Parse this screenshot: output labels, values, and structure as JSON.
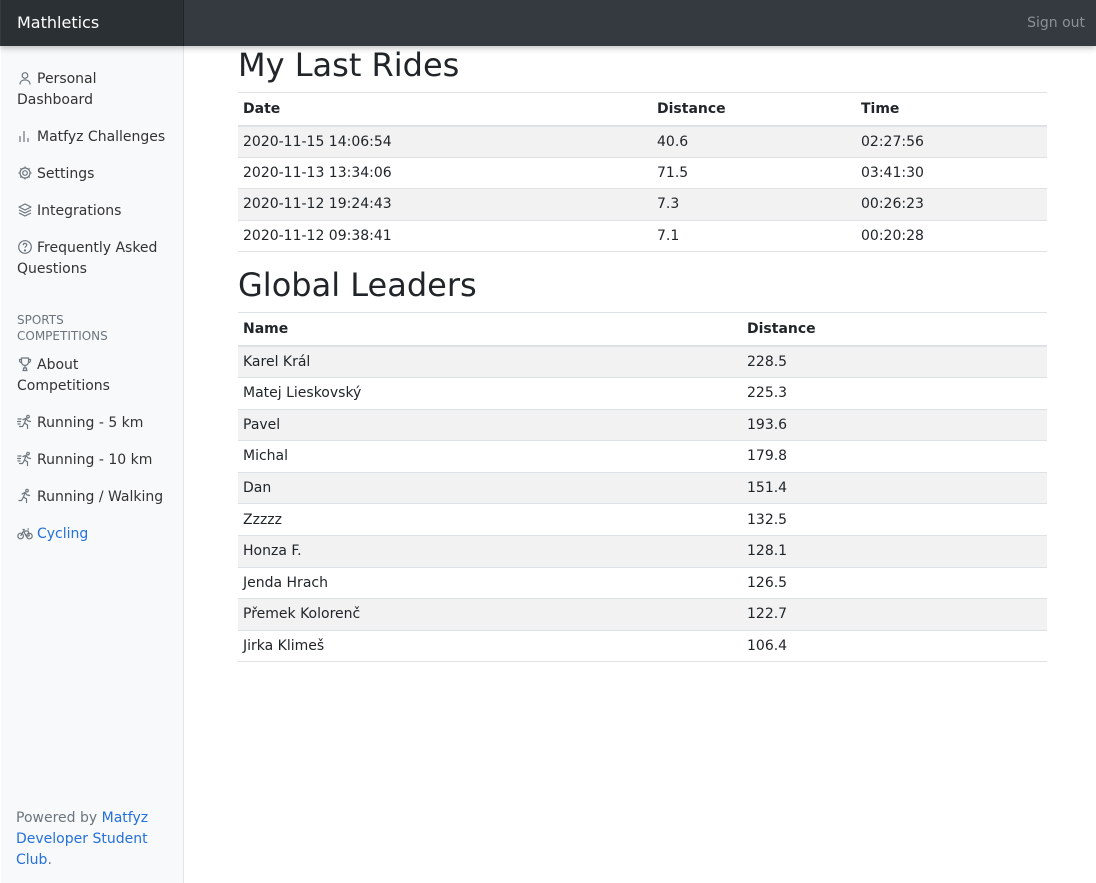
{
  "navbar": {
    "brand": "Mathletics",
    "sign_out": "Sign out"
  },
  "sidebar": {
    "items": [
      {
        "label": "Personal Dashboard",
        "icon": "user-icon"
      },
      {
        "label": "Matfyz Challenges",
        "icon": "bar-chart-icon"
      },
      {
        "label": "Settings",
        "icon": "gear-icon"
      },
      {
        "label": "Integrations",
        "icon": "layers-icon"
      },
      {
        "label": "Frequently Asked Questions",
        "icon": "help-circle-icon"
      }
    ],
    "section_heading": "SPORTS COMPETITIONS",
    "competitions": [
      {
        "label": "About Competitions",
        "icon": "trophy-icon"
      },
      {
        "label": "Running - 5 km",
        "icon": "runner-fast-icon"
      },
      {
        "label": "Running - 10 km",
        "icon": "runner-fast-icon"
      },
      {
        "label": "Running / Walking",
        "icon": "runner-icon"
      },
      {
        "label": "Cycling",
        "icon": "bicycle-icon",
        "active": true
      }
    ],
    "footer": {
      "prefix": "Powered by",
      "link_text": "Matfyz Developer Student Club",
      "suffix": "."
    }
  },
  "last_rides": {
    "title": "My Last Rides",
    "headers": {
      "date": "Date",
      "distance": "Distance",
      "time": "Time"
    },
    "rows": [
      {
        "date": "2020-11-15 14:06:54",
        "distance": "40.6",
        "time": "02:27:56"
      },
      {
        "date": "2020-11-13 13:34:06",
        "distance": "71.5",
        "time": "03:41:30"
      },
      {
        "date": "2020-11-12 19:24:43",
        "distance": "7.3",
        "time": "00:26:23"
      },
      {
        "date": "2020-11-12 09:38:41",
        "distance": "7.1",
        "time": "00:20:28"
      }
    ]
  },
  "leaders": {
    "title": "Global Leaders",
    "headers": {
      "name": "Name",
      "distance": "Distance"
    },
    "rows": [
      {
        "name": "Karel Král",
        "distance": "228.5"
      },
      {
        "name": "Matej Lieskovský",
        "distance": "225.3"
      },
      {
        "name": "Pavel",
        "distance": "193.6"
      },
      {
        "name": "Michal",
        "distance": "179.8"
      },
      {
        "name": "Dan",
        "distance": "151.4"
      },
      {
        "name": "Zzzzz",
        "distance": "132.5"
      },
      {
        "name": "Honza F.",
        "distance": "128.1"
      },
      {
        "name": "Jenda Hrach",
        "distance": "126.5"
      },
      {
        "name": "Přemek Kolorenč",
        "distance": "122.7"
      },
      {
        "name": "Jirka Klimeš",
        "distance": "106.4"
      }
    ]
  },
  "colors": {
    "navbar": "#343a40",
    "sidebar": "#f8f9fa",
    "link": "#2470dc",
    "stripe": "#f2f2f2"
  }
}
